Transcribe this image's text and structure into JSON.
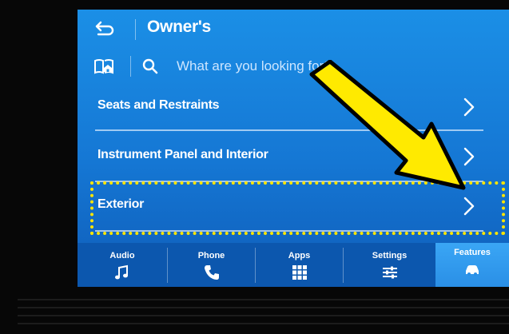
{
  "header": {
    "title": "Owner's"
  },
  "search": {
    "placeholder": "What are you looking for?"
  },
  "menu": {
    "items": [
      {
        "label": "Seats and Restraints"
      },
      {
        "label": "Instrument Panel and Interior"
      },
      {
        "label": "Exterior"
      }
    ]
  },
  "tabs": [
    {
      "label": "Audio",
      "icon": "music-note-icon"
    },
    {
      "label": "Phone",
      "icon": "phone-icon"
    },
    {
      "label": "Apps",
      "icon": "apps-grid-icon"
    },
    {
      "label": "Settings",
      "icon": "sliders-icon"
    },
    {
      "label": "Features",
      "icon": "car-icon",
      "active": true
    }
  ],
  "annotation": {
    "highlight_color": "#ffe600",
    "arrow_color": "#ffea00",
    "highlighted_item": "Exterior"
  },
  "colors": {
    "screen_blue": "#1577d4",
    "bottom_bar": "#0c57ae",
    "active_tab": "#2a8fe6"
  }
}
